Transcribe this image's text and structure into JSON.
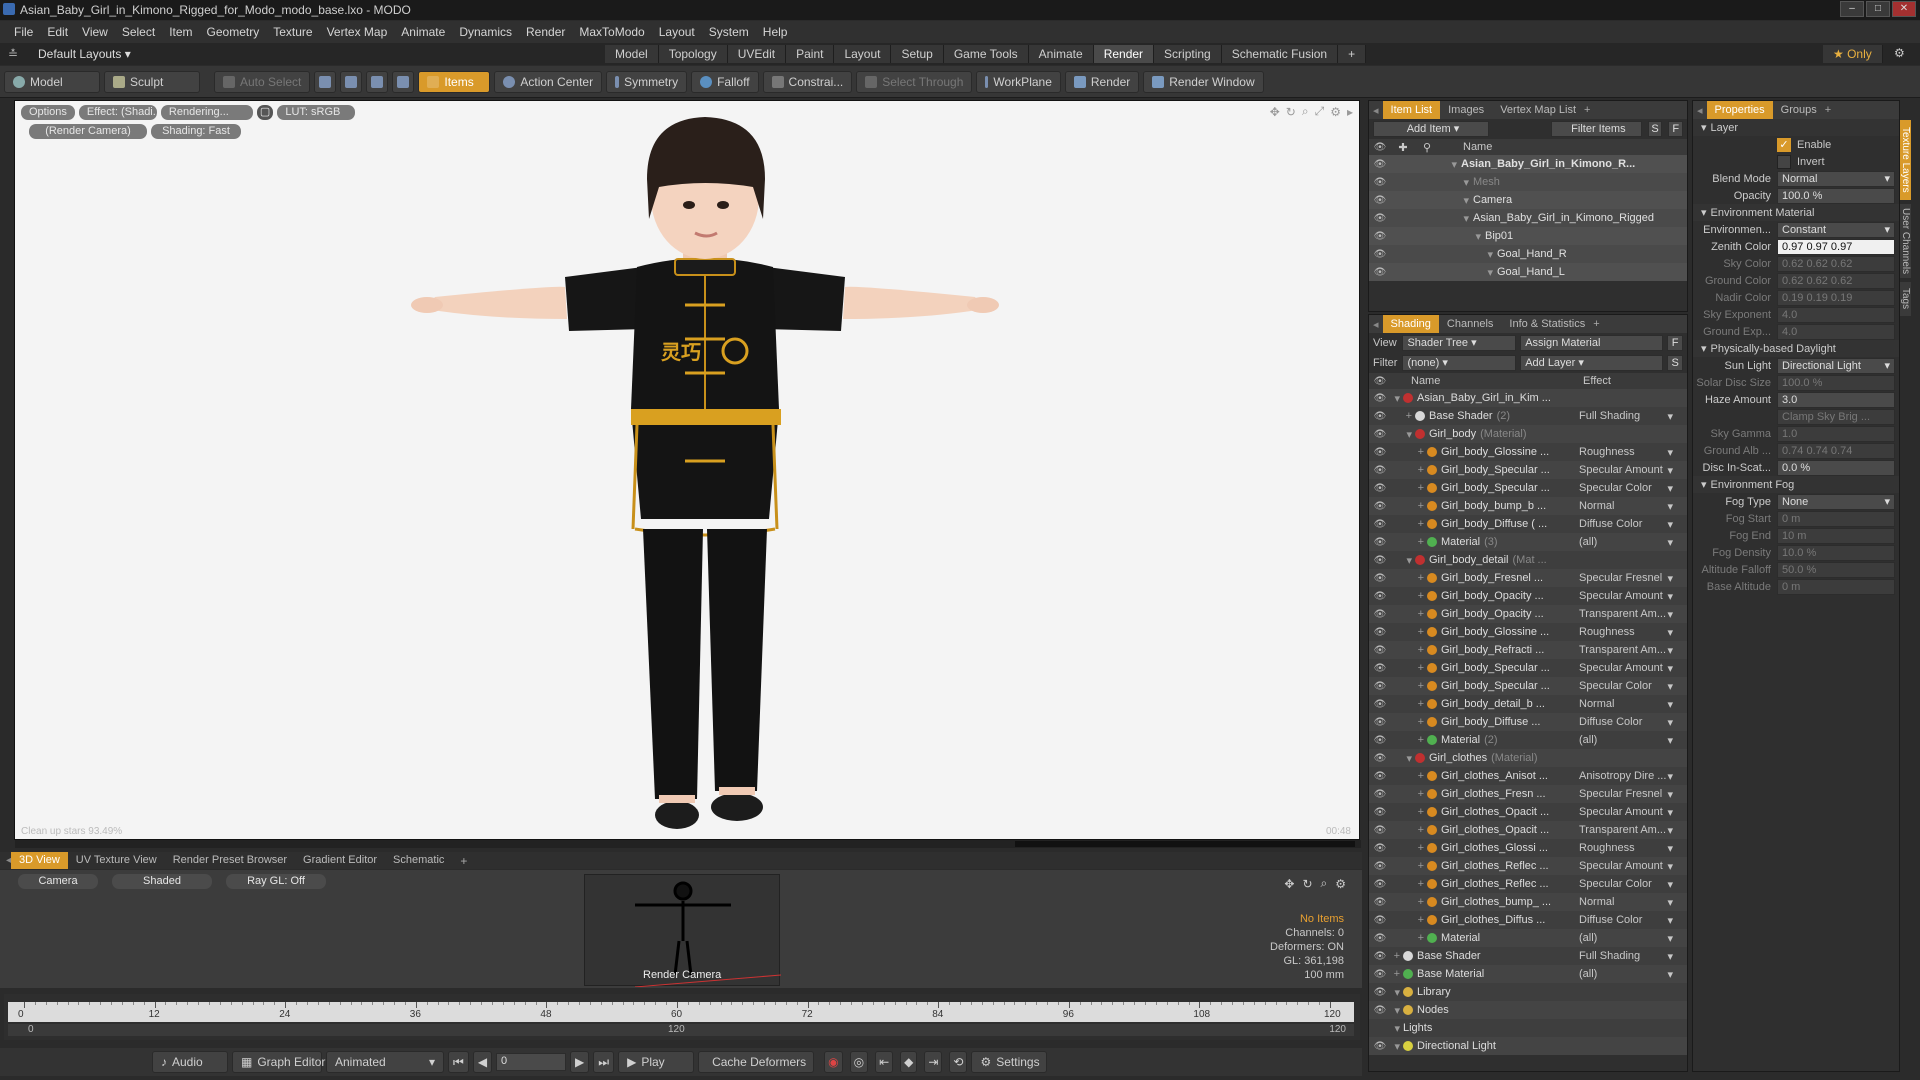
{
  "window": {
    "title": "Asian_Baby_Girl_in_Kimono_Rigged_for_Modo_modo_base.lxo - MODO"
  },
  "menu": [
    "File",
    "Edit",
    "View",
    "Select",
    "Item",
    "Geometry",
    "Texture",
    "Vertex Map",
    "Animate",
    "Dynamics",
    "Render",
    "MaxToModo",
    "Layout",
    "System",
    "Help"
  ],
  "layouts": {
    "label": "Default Layouts",
    "tabs": [
      "Model",
      "Topology",
      "UVEdit",
      "Paint",
      "Layout",
      "Setup",
      "Game Tools",
      "Animate",
      "Render",
      "Scripting",
      "Schematic Fusion"
    ],
    "active": "Render",
    "only": "Only"
  },
  "toolbar": {
    "model": "Model",
    "sculpt": "Sculpt",
    "auto_select": "Auto Select",
    "items": "Items",
    "action_center": "Action Center",
    "symmetry": "Symmetry",
    "falloff": "Falloff",
    "constraint": "Constrai...",
    "select_through": "Select Through",
    "workplane": "WorkPlane",
    "render": "Render",
    "render_window": "Render Window"
  },
  "viewport": {
    "tags": [
      "Options",
      "Effect: (Shadi...",
      "Rendering...",
      "LUT: sRGB"
    ],
    "tags2": [
      "(Render Camera)",
      "Shading: Fast"
    ],
    "bottom_left": "Clean up stars 93.49%",
    "bottom_right": "00:48"
  },
  "character": {
    "chest_text": "灵巧"
  },
  "bottom_tabs": [
    "3D View",
    "UV Texture View",
    "Render Preset Browser",
    "Gradient Editor",
    "Schematic"
  ],
  "view3d": {
    "camera": "Camera",
    "shaded": "Shaded",
    "raygl": "Ray GL: Off",
    "render_camera": "Render Camera",
    "info": {
      "no_items": "No Items",
      "channels": "Channels: 0",
      "deformers": "Deformers: ON",
      "gl": "GL: 361,198",
      "size": "100 mm"
    }
  },
  "timeline": {
    "ticks": [
      "0",
      "12",
      "24",
      "36",
      "48",
      "60",
      "72",
      "84",
      "96",
      "108",
      "120"
    ],
    "sub_ticks": [
      "0",
      "120",
      "120"
    ]
  },
  "transport": {
    "audio": "Audio",
    "graph_editor": "Graph Editor",
    "animated": "Animated",
    "frame": "0",
    "play": "Play",
    "cache": "Cache Deformers",
    "settings": "Settings"
  },
  "item_list": {
    "tabs": [
      "Item List",
      "Images",
      "Vertex Map List"
    ],
    "add_item": "Add Item",
    "filter": "Filter Items",
    "col_name": "Name",
    "rows": [
      {
        "label": "Asian_Baby_Girl_in_Kimono_R...",
        "indent": 0,
        "bold": true
      },
      {
        "label": "Mesh",
        "indent": 1,
        "dim": true
      },
      {
        "label": "Camera",
        "indent": 1
      },
      {
        "label": "Asian_Baby_Girl_in_Kimono_Rigged",
        "indent": 1
      },
      {
        "label": "Bip01",
        "indent": 2
      },
      {
        "label": "Goal_Hand_R",
        "indent": 3
      },
      {
        "label": "Goal_Hand_L",
        "indent": 3
      }
    ]
  },
  "shading": {
    "tabs": [
      "Shading",
      "Channels",
      "Info & Statistics"
    ],
    "view_label": "View",
    "view_value": "Shader Tree",
    "assign": "Assign Material",
    "filter_label": "Filter",
    "filter_value": "(none)",
    "add_layer": "Add Layer",
    "col_name": "Name",
    "col_effect": "Effect",
    "rows": [
      {
        "label": "Asian_Baby_Girl_in_Kim ...",
        "effect": "",
        "indent": 0,
        "ball": "#c03030"
      },
      {
        "label": "Base Shader",
        "sub": "(2)",
        "effect": "Full Shading",
        "indent": 1,
        "ball": "#d8d8d8"
      },
      {
        "label": "Girl_body",
        "sub": "(Material)",
        "effect": "",
        "indent": 1,
        "ball": "#c03030"
      },
      {
        "label": "Girl_body_Glossine ...",
        "effect": "Roughness",
        "indent": 2,
        "ball": "#d88a20"
      },
      {
        "label": "Girl_body_Specular ...",
        "effect": "Specular Amount",
        "indent": 2,
        "ball": "#d88a20"
      },
      {
        "label": "Girl_body_Specular ...",
        "effect": "Specular Color",
        "indent": 2,
        "ball": "#d88a20"
      },
      {
        "label": "Girl_body_bump_b ...",
        "effect": "Normal",
        "indent": 2,
        "ball": "#d88a20"
      },
      {
        "label": "Girl_body_Diffuse ( ...",
        "effect": "Diffuse Color",
        "indent": 2,
        "ball": "#d88a20"
      },
      {
        "label": "Material",
        "sub": "(3)",
        "effect": "(all)",
        "indent": 2,
        "ball": "#50b050"
      },
      {
        "label": "Girl_body_detail",
        "sub": "(Mat ...",
        "effect": "",
        "indent": 1,
        "ball": "#c03030"
      },
      {
        "label": "Girl_body_Fresnel ...",
        "effect": "Specular Fresnel",
        "indent": 2,
        "ball": "#d88a20"
      },
      {
        "label": "Girl_body_Opacity ...",
        "effect": "Specular Amount",
        "indent": 2,
        "ball": "#d88a20"
      },
      {
        "label": "Girl_body_Opacity ...",
        "effect": "Transparent Am...",
        "indent": 2,
        "ball": "#d88a20"
      },
      {
        "label": "Girl_body_Glossine ...",
        "effect": "Roughness",
        "indent": 2,
        "ball": "#d88a20"
      },
      {
        "label": "Girl_body_Refracti ...",
        "effect": "Transparent Am...",
        "indent": 2,
        "ball": "#d88a20"
      },
      {
        "label": "Girl_body_Specular ...",
        "effect": "Specular Amount",
        "indent": 2,
        "ball": "#d88a20"
      },
      {
        "label": "Girl_body_Specular ...",
        "effect": "Specular Color",
        "indent": 2,
        "ball": "#d88a20"
      },
      {
        "label": "Girl_body_detail_b ...",
        "effect": "Normal",
        "indent": 2,
        "ball": "#d88a20"
      },
      {
        "label": "Girl_body_Diffuse ...",
        "effect": "Diffuse Color",
        "indent": 2,
        "ball": "#d88a20"
      },
      {
        "label": "Material",
        "sub": "(2)",
        "effect": "(all)",
        "indent": 2,
        "ball": "#50b050"
      },
      {
        "label": "Girl_clothes",
        "sub": "(Material)",
        "effect": "",
        "indent": 1,
        "ball": "#c03030"
      },
      {
        "label": "Girl_clothes_Anisot ...",
        "effect": "Anisotropy Dire ...",
        "indent": 2,
        "ball": "#d88a20"
      },
      {
        "label": "Girl_clothes_Fresn ...",
        "effect": "Specular Fresnel",
        "indent": 2,
        "ball": "#d88a20"
      },
      {
        "label": "Girl_clothes_Opacit ...",
        "effect": "Specular Amount",
        "indent": 2,
        "ball": "#d88a20"
      },
      {
        "label": "Girl_clothes_Opacit ...",
        "effect": "Transparent Am...",
        "indent": 2,
        "ball": "#d88a20"
      },
      {
        "label": "Girl_clothes_Glossi ...",
        "effect": "Roughness",
        "indent": 2,
        "ball": "#d88a20"
      },
      {
        "label": "Girl_clothes_Reflec ...",
        "effect": "Specular Amount",
        "indent": 2,
        "ball": "#d88a20"
      },
      {
        "label": "Girl_clothes_Reflec ...",
        "effect": "Specular Color",
        "indent": 2,
        "ball": "#d88a20"
      },
      {
        "label": "Girl_clothes_bump_ ...",
        "effect": "Normal",
        "indent": 2,
        "ball": "#d88a20"
      },
      {
        "label": "Girl_clothes_Diffus ...",
        "effect": "Diffuse Color",
        "indent": 2,
        "ball": "#d88a20"
      },
      {
        "label": "Material",
        "effect": "(all)",
        "indent": 2,
        "ball": "#50b050"
      },
      {
        "label": "Base Shader",
        "effect": "Full Shading",
        "indent": 0,
        "ball": "#d8d8d8"
      },
      {
        "label": "Base Material",
        "effect": "(all)",
        "indent": 0,
        "ball": "#50b050"
      },
      {
        "label": "Library",
        "effect": "",
        "indent": 0,
        "ball": "#d8b040"
      },
      {
        "label": "Nodes",
        "effect": "",
        "indent": 0,
        "ball": "#d8b040"
      },
      {
        "label": "Lights",
        "effect": "",
        "indent": -1,
        "ball": ""
      },
      {
        "label": "Directional Light",
        "effect": "",
        "indent": 0,
        "ball": "#d8d040"
      }
    ]
  },
  "properties": {
    "tabs": [
      "Properties",
      "Groups"
    ],
    "side_tabs": [
      "Texture Layers",
      "User Channels",
      "Tags"
    ],
    "layer": "Layer",
    "enable": "Enable",
    "invert": "Invert",
    "rows": [
      {
        "label": "Blend Mode",
        "value": "Normal",
        "type": "select"
      },
      {
        "label": "Opacity",
        "value": "100.0 %",
        "type": "field"
      },
      {
        "section": "Environment Material"
      },
      {
        "label": "Environmen...",
        "value": "Constant",
        "type": "select"
      },
      {
        "label": "Zenith Color",
        "value": "0.97 0.97 0.97",
        "type": "white"
      },
      {
        "label": "Sky Color",
        "value": "0.62 0.62 0.62",
        "type": "dim"
      },
      {
        "label": "Ground Color",
        "value": "0.62 0.62 0.62",
        "type": "dim"
      },
      {
        "label": "Nadir Color",
        "value": "0.19 0.19 0.19",
        "type": "dim"
      },
      {
        "label": "Sky Exponent",
        "value": "4.0",
        "type": "dim"
      },
      {
        "label": "Ground Exp...",
        "value": "4.0",
        "type": "dim"
      },
      {
        "section": "Physically-based Daylight"
      },
      {
        "label": "Sun Light",
        "value": "Directional Light",
        "type": "select"
      },
      {
        "label": "Solar Disc Size",
        "value": "100.0 %",
        "type": "dim"
      },
      {
        "label": "Haze Amount",
        "value": "3.0",
        "type": "field"
      },
      {
        "label": "",
        "value": "Clamp Sky Brig ...",
        "type": "dimcheck"
      },
      {
        "label": "Sky Gamma",
        "value": "1.0",
        "type": "dim"
      },
      {
        "label": "Ground Alb ...",
        "value": "0.74 0.74 0.74",
        "type": "dim"
      },
      {
        "label": "Disc In-Scat...",
        "value": "0.0 %",
        "type": "field"
      },
      {
        "section": "Environment Fog"
      },
      {
        "label": "Fog Type",
        "value": "None",
        "type": "select"
      },
      {
        "label": "Fog Start",
        "value": "0 m",
        "type": "dim"
      },
      {
        "label": "Fog End",
        "value": "10 m",
        "type": "dim"
      },
      {
        "label": "Fog Density",
        "value": "10.0 %",
        "type": "dim"
      },
      {
        "label": "Altitude Falloff",
        "value": "50.0 %",
        "type": "dim"
      },
      {
        "label": "Base Altitude",
        "value": "0 m",
        "type": "dim"
      }
    ]
  }
}
